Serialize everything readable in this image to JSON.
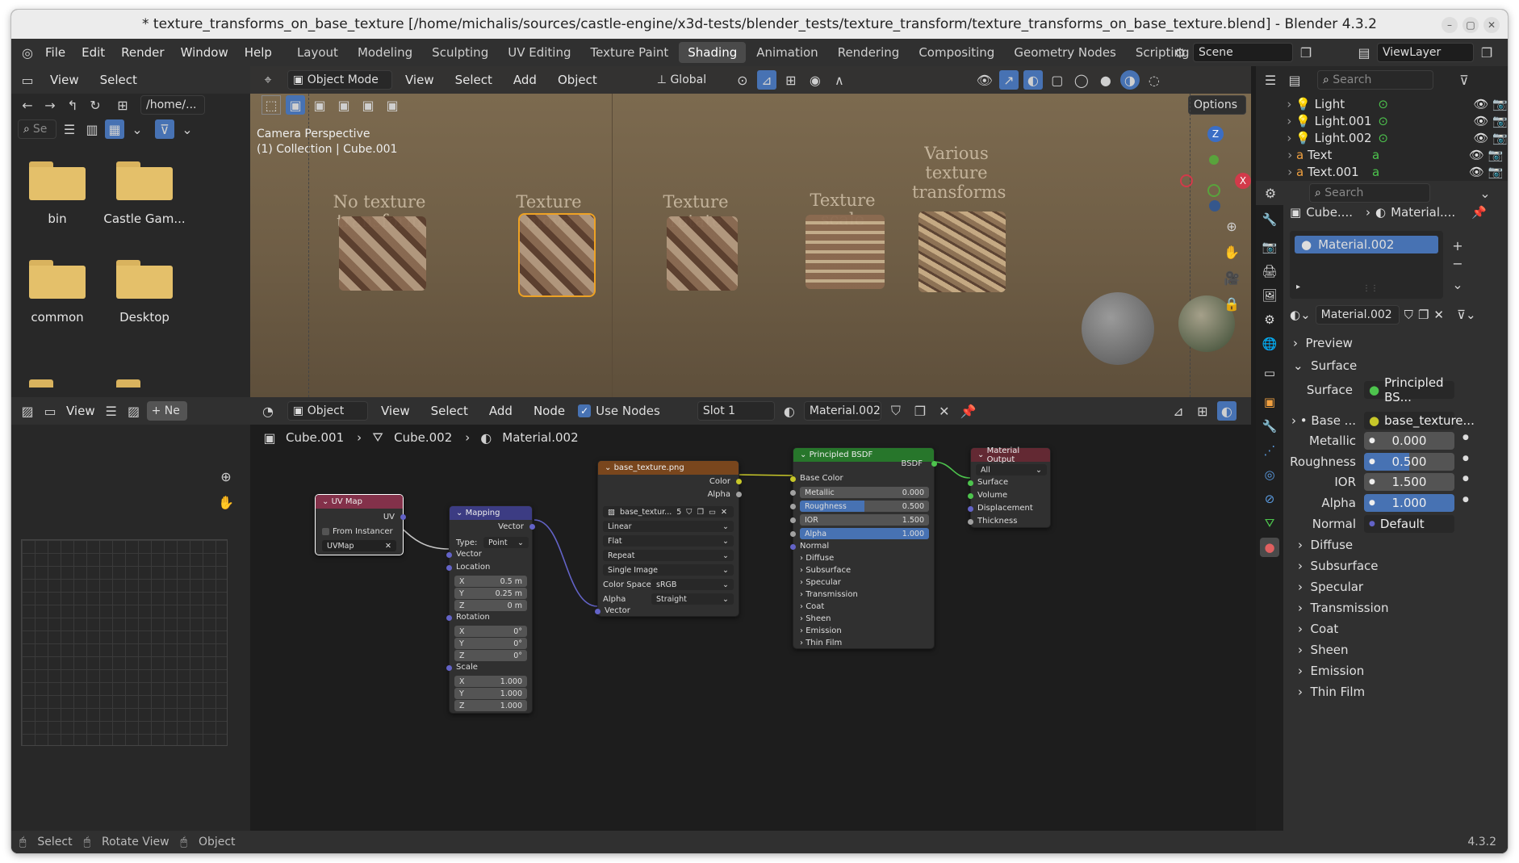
{
  "window": {
    "title": "* texture_transforms_on_base_texture [/home/michalis/sources/castle-engine/x3d-tests/blender_tests/texture_transform/texture_transforms_on_base_texture.blend] - Blender 4.3.2"
  },
  "menubar": {
    "items": [
      "File",
      "Edit",
      "Render",
      "Window",
      "Help"
    ],
    "workspaces": [
      "Layout",
      "Modeling",
      "Sculpting",
      "UV Editing",
      "Texture Paint",
      "Shading",
      "Animation",
      "Rendering",
      "Compositing",
      "Geometry Nodes",
      "Scripting"
    ],
    "active_workspace": "Shading",
    "scene": "Scene",
    "view_layer": "ViewLayer"
  },
  "file_browser": {
    "menu": [
      "View",
      "Select"
    ],
    "path": "/home/...",
    "search_placeholder": "Se",
    "folders": [
      "bin",
      "Castle Gam...",
      "common",
      "Desktop"
    ]
  },
  "viewport": {
    "mode": "Object Mode",
    "menu": [
      "View",
      "Select",
      "Add",
      "Object"
    ],
    "orientation": "Global",
    "options_label": "Options",
    "overlay_line1": "Camera Perspective",
    "overlay_line2": "(1) Collection | Cube.001",
    "cube_labels": [
      "No texture transform",
      "Texture move",
      "Texture rotate",
      "Texture scale",
      "Various texture transforms"
    ],
    "gizmo_axes": [
      "Z",
      "X"
    ]
  },
  "node_editor": {
    "mode": "Object",
    "menu": [
      "View",
      "Select",
      "Add",
      "Node"
    ],
    "use_nodes_label": "Use Nodes",
    "slot": "Slot 1",
    "material": "Material.002",
    "breadcrumbs": [
      "Cube.001",
      "Cube.002",
      "Material.002"
    ],
    "left_menu_view": "View",
    "left_new_label": "Ne",
    "nodes": {
      "uvmap": {
        "title": "UV Map",
        "output": "UV",
        "from_instancer": "From Instancer",
        "map": "UVMap"
      },
      "mapping": {
        "title": "Mapping",
        "output": "Vector",
        "type_label": "Type:",
        "type": "Point",
        "input": "Vector",
        "location_label": "Location",
        "location": [
          {
            "k": "X",
            "v": "0.5 m"
          },
          {
            "k": "Y",
            "v": "0.25 m"
          },
          {
            "k": "Z",
            "v": "0 m"
          }
        ],
        "rotation_label": "Rotation",
        "rotation": [
          {
            "k": "X",
            "v": "0°"
          },
          {
            "k": "Y",
            "v": "0°"
          },
          {
            "k": "Z",
            "v": "0°"
          }
        ],
        "scale_label": "Scale",
        "scale": [
          {
            "k": "X",
            "v": "1.000"
          },
          {
            "k": "Y",
            "v": "1.000"
          },
          {
            "k": "Z",
            "v": "1.000"
          }
        ]
      },
      "image": {
        "title": "base_texture.png",
        "out_color": "Color",
        "out_alpha": "Alpha",
        "image_name": "base_textur...",
        "users": "5",
        "interpolation": "Linear",
        "projection": "Flat",
        "extension": "Repeat",
        "source": "Single Image",
        "color_space_label": "Color Space",
        "color_space": "sRGB",
        "alpha_label": "Alpha",
        "alpha": "Straight",
        "in_vector": "Vector"
      },
      "bsdf": {
        "title": "Principled BSDF",
        "output": "BSDF",
        "base_color": "Base Color",
        "metallic_label": "Metallic",
        "metallic": "0.000",
        "roughness_label": "Roughness",
        "roughness": "0.500",
        "ior_label": "IOR",
        "ior": "1.500",
        "alpha_label": "Alpha",
        "alpha": "1.000",
        "normal": "Normal",
        "panels": [
          "Diffuse",
          "Subsurface",
          "Specular",
          "Transmission",
          "Coat",
          "Sheen",
          "Emission",
          "Thin Film"
        ]
      },
      "output": {
        "title": "Material Output",
        "target": "All",
        "inputs": [
          "Surface",
          "Volume",
          "Displacement",
          "Thickness"
        ]
      }
    }
  },
  "outliner": {
    "search_placeholder": "Search",
    "items": [
      {
        "name": "Light"
      },
      {
        "name": "Light.001"
      },
      {
        "name": "Light.002"
      },
      {
        "name": "Text"
      },
      {
        "name": "Text.001"
      }
    ]
  },
  "properties": {
    "search_placeholder": "Search",
    "breadcrumb_object": "Cube....",
    "breadcrumb_material": "Material....",
    "slot_item": "Material.002",
    "material_name": "Material.002",
    "preview_label": "Preview",
    "surface_section": "Surface",
    "surface_label": "Surface",
    "surface_value": "Principled BS...",
    "base_label": "Base ...",
    "base_value": "base_texture...",
    "metallic_label": "Metallic",
    "metallic": "0.000",
    "roughness_label": "Roughness",
    "roughness": "0.500",
    "ior_label": "IOR",
    "ior": "1.500",
    "alpha_label": "Alpha",
    "alpha": "1.000",
    "normal_label": "Normal",
    "normal_value": "Default",
    "sections": [
      "Diffuse",
      "Subsurface",
      "Specular",
      "Transmission",
      "Coat",
      "Sheen",
      "Emission",
      "Thin Film"
    ]
  },
  "statusbar": {
    "hints": [
      "Select",
      "Rotate View",
      "Object"
    ],
    "version": "4.3.2"
  },
  "colors": {
    "accent_blue": "#4772b3",
    "uv_header": "#83314a",
    "vector_header": "#3c3c83",
    "image_header": "#79461d",
    "bsdf_header": "#27762b",
    "output_header": "#632933",
    "link_yellow": "#c7c729",
    "link_purple": "#6363c7",
    "link_green": "#4dc44d"
  }
}
